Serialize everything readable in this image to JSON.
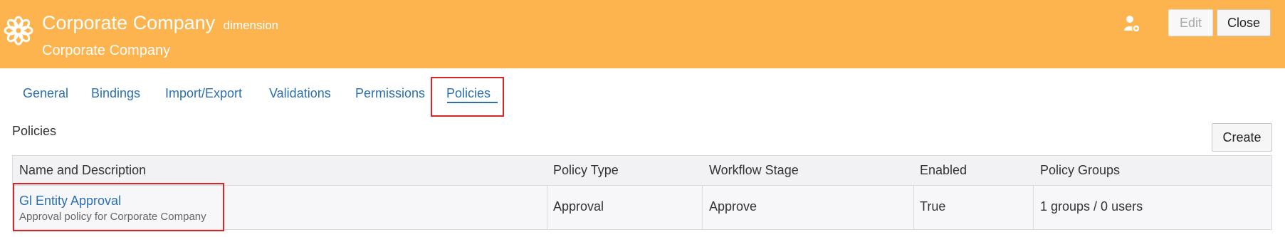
{
  "header": {
    "title": "Corporate Company",
    "type_label": "dimension",
    "subtitle": "Corporate Company",
    "logo_icon": "flower-icon",
    "user_icon": "user-settings-icon",
    "edit_label": "Edit",
    "close_label": "Close",
    "background_color": "#fdb44f"
  },
  "tabs": [
    {
      "label": "General"
    },
    {
      "label": "Bindings"
    },
    {
      "label": "Import/Export"
    },
    {
      "label": "Validations"
    },
    {
      "label": "Permissions"
    },
    {
      "label": "Policies",
      "active": true
    }
  ],
  "section": {
    "title": "Policies",
    "create_label": "Create"
  },
  "table": {
    "headers": [
      "Name and Description",
      "Policy Type",
      "Workflow Stage",
      "Enabled",
      "Policy Groups"
    ],
    "rows": [
      {
        "name": "Gl Entity Approval",
        "description": "Approval policy for Corporate Company",
        "policy_type": "Approval",
        "workflow_stage": "Approve",
        "enabled": "True",
        "policy_groups": "1 groups / 0 users"
      }
    ]
  },
  "colors": {
    "accent": "#2a6fb1",
    "highlight": "#d7262a"
  }
}
